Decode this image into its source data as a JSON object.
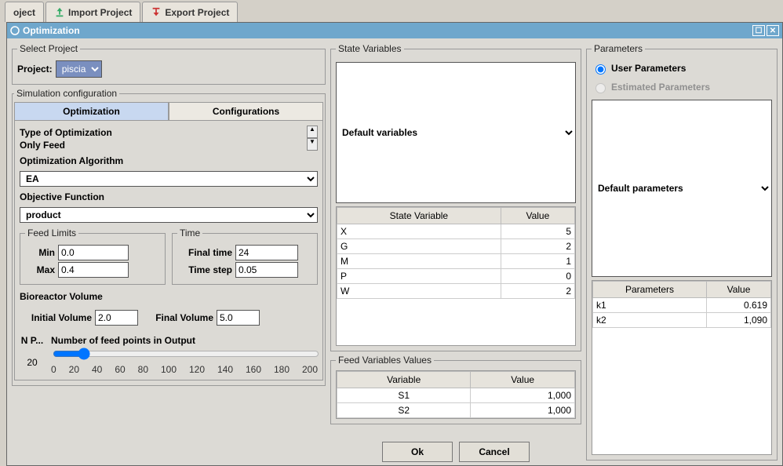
{
  "back_tabs": [
    "oject",
    "Import Project",
    "Export Project"
  ],
  "dialog": {
    "title": "Optimization"
  },
  "select_project": {
    "legend": "Select Project",
    "label": "Project:",
    "value": "piscia"
  },
  "sim_config_legend": "Simulation configuration",
  "tabs": {
    "opt": "Optimization",
    "conf": "Configurations"
  },
  "opt_type": {
    "label": "Type of Optimization",
    "value": "Only Feed"
  },
  "opt_algo": {
    "label": "Optimization Algorithm",
    "value": "EA"
  },
  "obj_fn": {
    "label": "Objective Function",
    "value": "product"
  },
  "feed_limits": {
    "legend": "Feed Limits",
    "min_label": "Min",
    "min": "0.0",
    "max_label": "Max",
    "max": "0.4"
  },
  "time": {
    "legend": "Time",
    "final_label": "Final time",
    "final": "24",
    "step_label": "Time step",
    "step": "0.05"
  },
  "bioreactor": {
    "label": "Bioreactor Volume",
    "init_label": "Initial Volume",
    "init": "2.0",
    "final_label": "Final Volume",
    "final": "5.0"
  },
  "feed_points": {
    "short": "N P...",
    "long": "Number of feed points in Output",
    "value": "20",
    "ticks": [
      "0",
      "20",
      "40",
      "60",
      "80",
      "100",
      "120",
      "140",
      "160",
      "180",
      "200"
    ]
  },
  "state_vars": {
    "legend": "State Variables",
    "selector": "Default variables",
    "headers": [
      "State Variable",
      "Value"
    ],
    "rows": [
      {
        "n": "X",
        "v": "5"
      },
      {
        "n": "G",
        "v": "2"
      },
      {
        "n": "M",
        "v": "1"
      },
      {
        "n": "P",
        "v": "0"
      },
      {
        "n": "W",
        "v": "2"
      }
    ]
  },
  "feed_vars": {
    "legend": "Feed Variables Values",
    "headers": [
      "Variable",
      "Value"
    ],
    "rows": [
      {
        "n": "S1",
        "v": "1,000"
      },
      {
        "n": "S2",
        "v": "1,000"
      }
    ]
  },
  "params": {
    "legend": "Parameters",
    "radio_user": "User Parameters",
    "radio_est": "Estimated Parameters",
    "selector": "Default parameters",
    "headers": [
      "Parameters",
      "Value"
    ],
    "rows": [
      {
        "n": "k1",
        "v": "0.619"
      },
      {
        "n": "k2",
        "v": "1,090"
      }
    ]
  },
  "buttons": {
    "ok": "Ok",
    "cancel": "Cancel"
  }
}
